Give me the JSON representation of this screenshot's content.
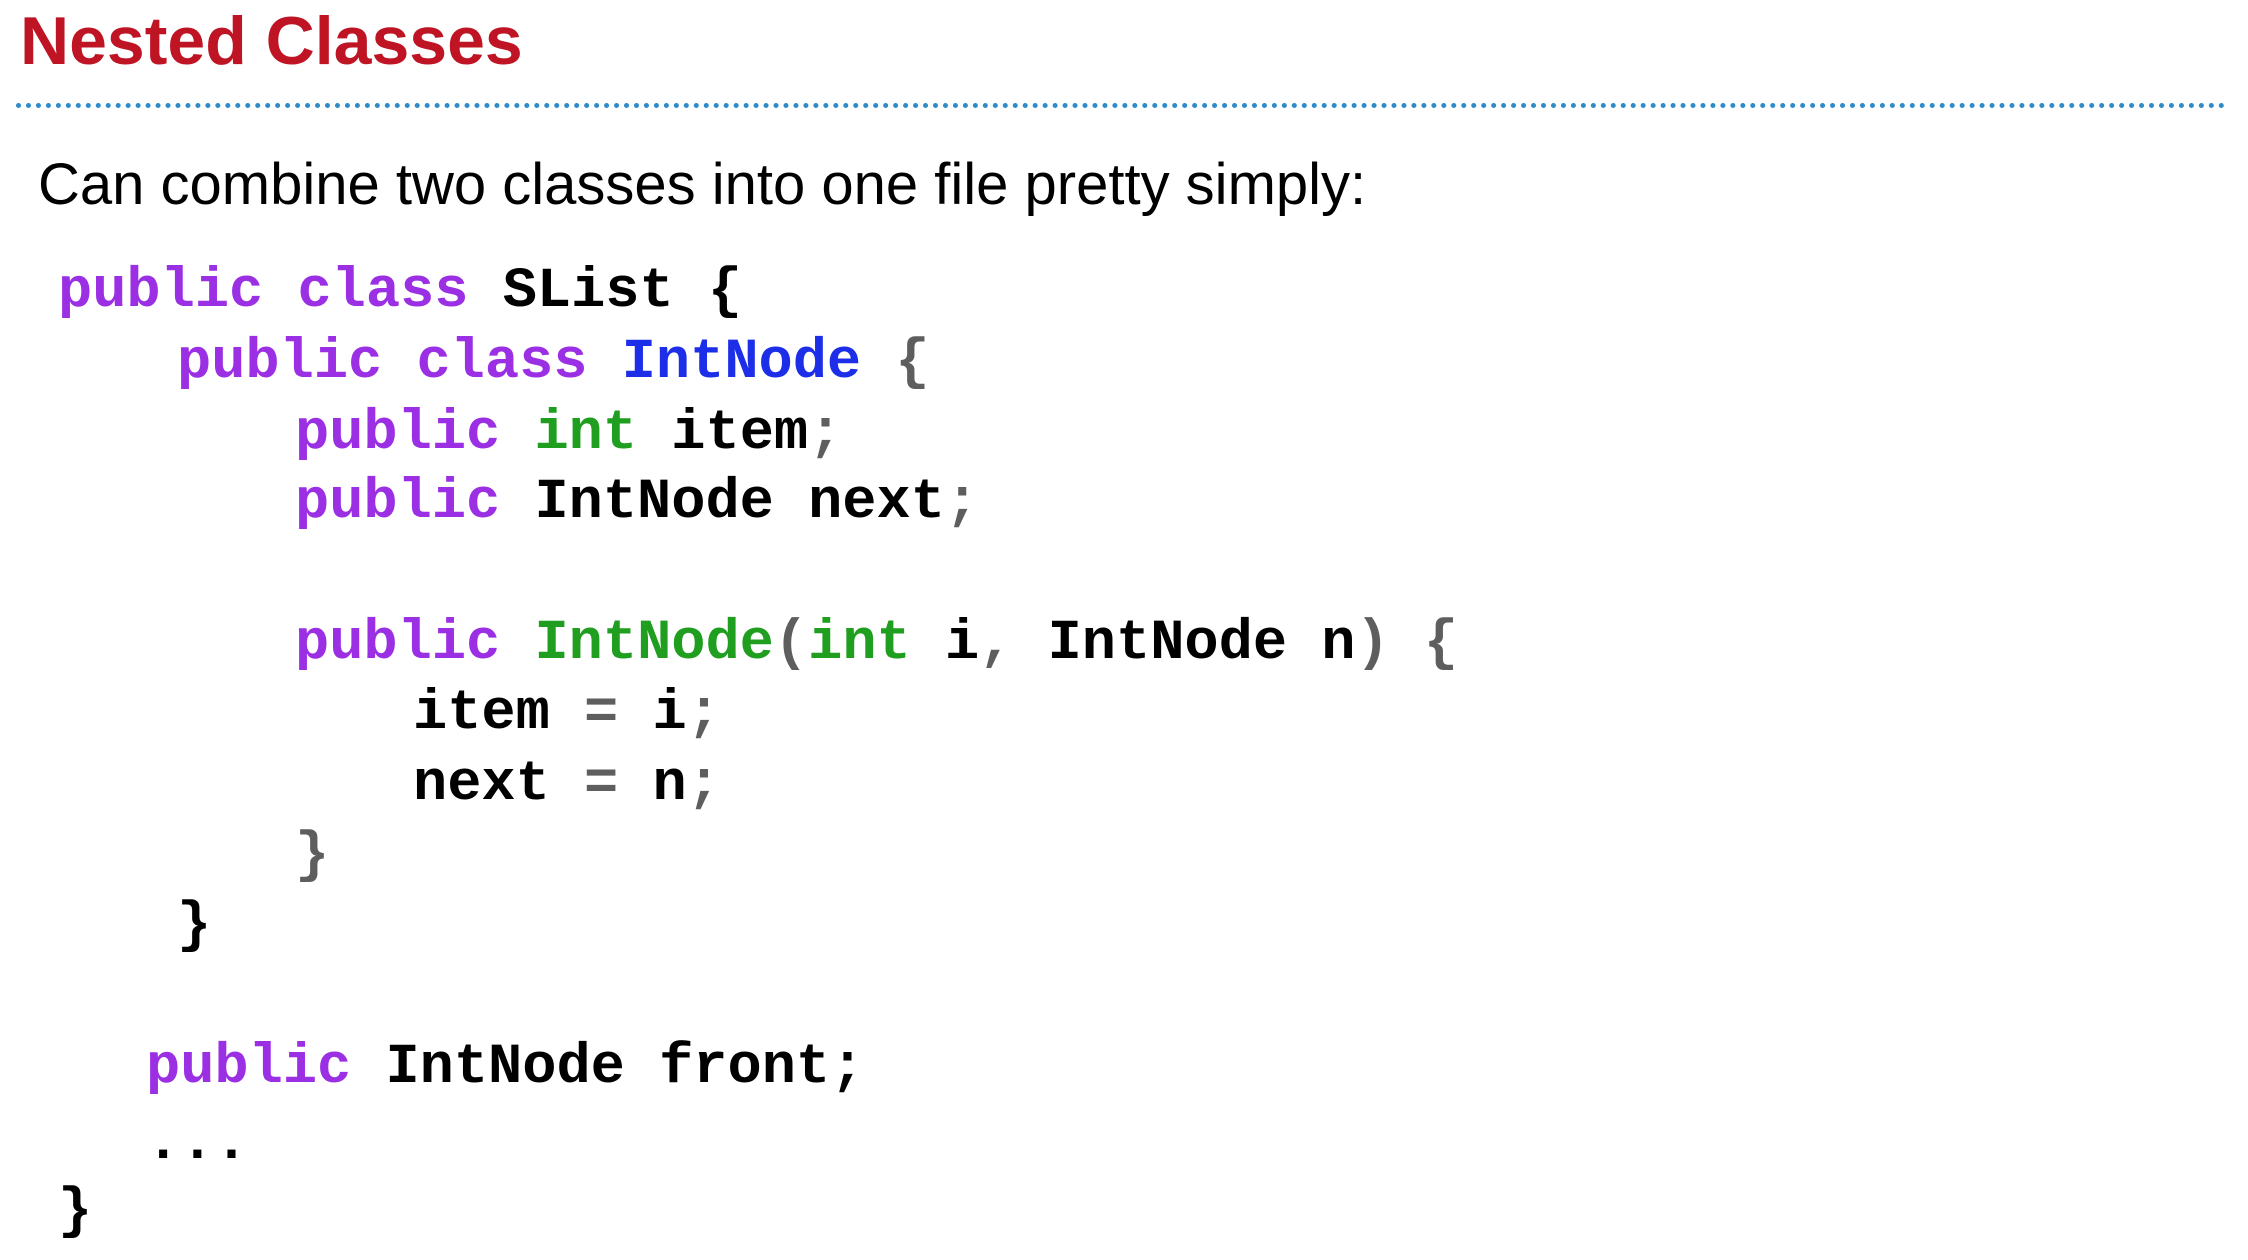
{
  "slide": {
    "title": "Nested Classes",
    "intro": "Can combine two classes into one file pretty simply:"
  },
  "colors": {
    "title": "#be1424",
    "rule": "#2e8bc9",
    "keyword": "#9b2fe3",
    "primitive_type": "#1f9e1f",
    "class_name": "#1c2ee8",
    "punctuation": "#5e5e5e",
    "identifier": "#000000"
  },
  "code": {
    "lines": [
      [
        {
          "text": "public",
          "role": "keyword"
        },
        {
          "text": " ",
          "role": "space"
        },
        {
          "text": "class",
          "role": "keyword"
        },
        {
          "text": " SList {",
          "role": "identifier"
        }
      ],
      [
        {
          "text": "public",
          "role": "keyword"
        },
        {
          "text": " ",
          "role": "space"
        },
        {
          "text": "class",
          "role": "keyword"
        },
        {
          "text": " ",
          "role": "space"
        },
        {
          "text": "IntNode",
          "role": "class_name"
        },
        {
          "text": " ",
          "role": "space"
        },
        {
          "text": "{",
          "role": "punctuation"
        }
      ],
      [
        {
          "text": "public",
          "role": "keyword"
        },
        {
          "text": " ",
          "role": "space"
        },
        {
          "text": "int",
          "role": "primitive_type"
        },
        {
          "text": " item",
          "role": "identifier"
        },
        {
          "text": ";",
          "role": "punctuation"
        }
      ],
      [
        {
          "text": "public",
          "role": "keyword"
        },
        {
          "text": " IntNode next",
          "role": "identifier"
        },
        {
          "text": ";",
          "role": "punctuation"
        }
      ],
      [
        {
          "text": "public",
          "role": "keyword"
        },
        {
          "text": " ",
          "role": "space"
        },
        {
          "text": "IntNode",
          "role": "primitive_type"
        },
        {
          "text": "(",
          "role": "punctuation"
        },
        {
          "text": "int",
          "role": "primitive_type"
        },
        {
          "text": " i",
          "role": "identifier"
        },
        {
          "text": ",",
          "role": "punctuation"
        },
        {
          "text": " IntNode n",
          "role": "identifier"
        },
        {
          "text": ")",
          "role": "punctuation"
        },
        {
          "text": " ",
          "role": "space"
        },
        {
          "text": "{",
          "role": "punctuation"
        }
      ],
      [
        {
          "text": "item",
          "role": "identifier"
        },
        {
          "text": " = ",
          "role": "punctuation"
        },
        {
          "text": "i",
          "role": "identifier"
        },
        {
          "text": ";",
          "role": "punctuation"
        }
      ],
      [
        {
          "text": "next",
          "role": "identifier"
        },
        {
          "text": " = ",
          "role": "punctuation"
        },
        {
          "text": "n",
          "role": "identifier"
        },
        {
          "text": ";",
          "role": "punctuation"
        }
      ],
      [
        {
          "text": "}",
          "role": "punctuation"
        }
      ],
      [
        {
          "text": "}",
          "role": "identifier"
        }
      ],
      [
        {
          "text": "public",
          "role": "keyword"
        },
        {
          "text": " IntNode front;",
          "role": "identifier"
        }
      ],
      [
        {
          "text": "...",
          "role": "identifier"
        }
      ],
      [
        {
          "text": "}",
          "role": "identifier"
        }
      ]
    ]
  }
}
